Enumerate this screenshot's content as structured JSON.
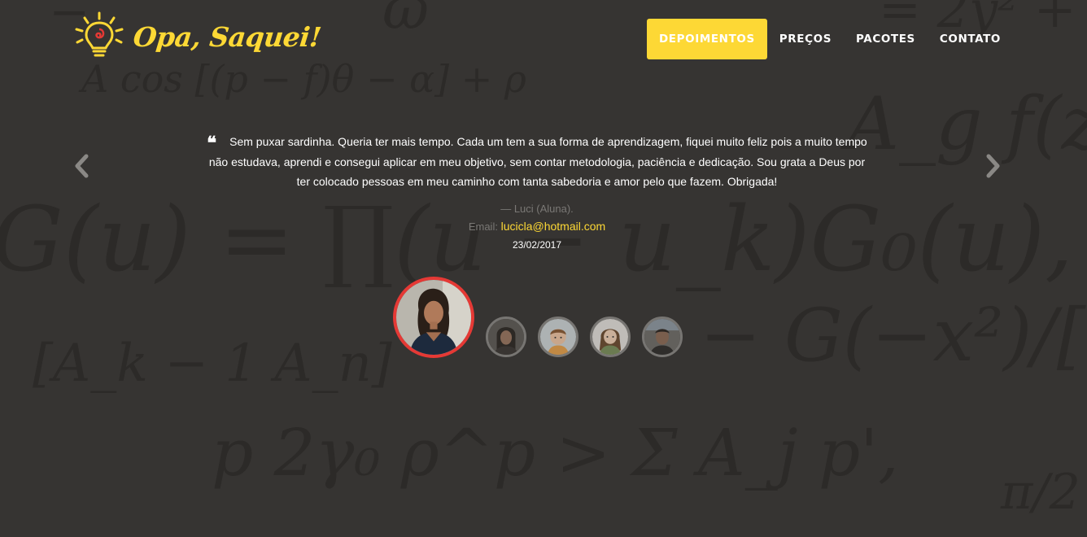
{
  "brand": {
    "name": "Opa, Saquei!",
    "icon": "lightbulb-logo-icon",
    "color": "#fdd835"
  },
  "nav": {
    "items": [
      {
        "label": "DEPOIMENTOS",
        "active": true
      },
      {
        "label": "PREÇOS",
        "active": false
      },
      {
        "label": "PACOTES",
        "active": false
      },
      {
        "label": "CONTATO",
        "active": false
      }
    ]
  },
  "carousel": {
    "prev_icon": "chevron-left-icon",
    "next_icon": "chevron-right-icon"
  },
  "testimonial": {
    "quote_icon": "quote-icon",
    "quote_mark": "❝",
    "text": "Sem puxar sardinha. Queria ter mais tempo. Cada um tem a sua forma de aprendizagem, fiquei muito feliz pois a muito tempo não estudava, aprendi e consegui aplicar em meu objetivo, sem contar metodologia, paciência e dedicação. Sou grata a Deus por ter colocado pessoas em meu caminho com tanta sabedoria e amor pelo que fazem. Obrigada!",
    "author": "— Luci (Aluna).",
    "email_label": "Email:",
    "email": "lucicla@hotmail.com",
    "date": "23/02/2017"
  },
  "avatars": [
    {
      "name": "avatar-luci",
      "selected": true
    },
    {
      "name": "avatar-2",
      "selected": false
    },
    {
      "name": "avatar-3",
      "selected": false
    },
    {
      "name": "avatar-4",
      "selected": false
    },
    {
      "name": "avatar-5",
      "selected": false
    }
  ]
}
